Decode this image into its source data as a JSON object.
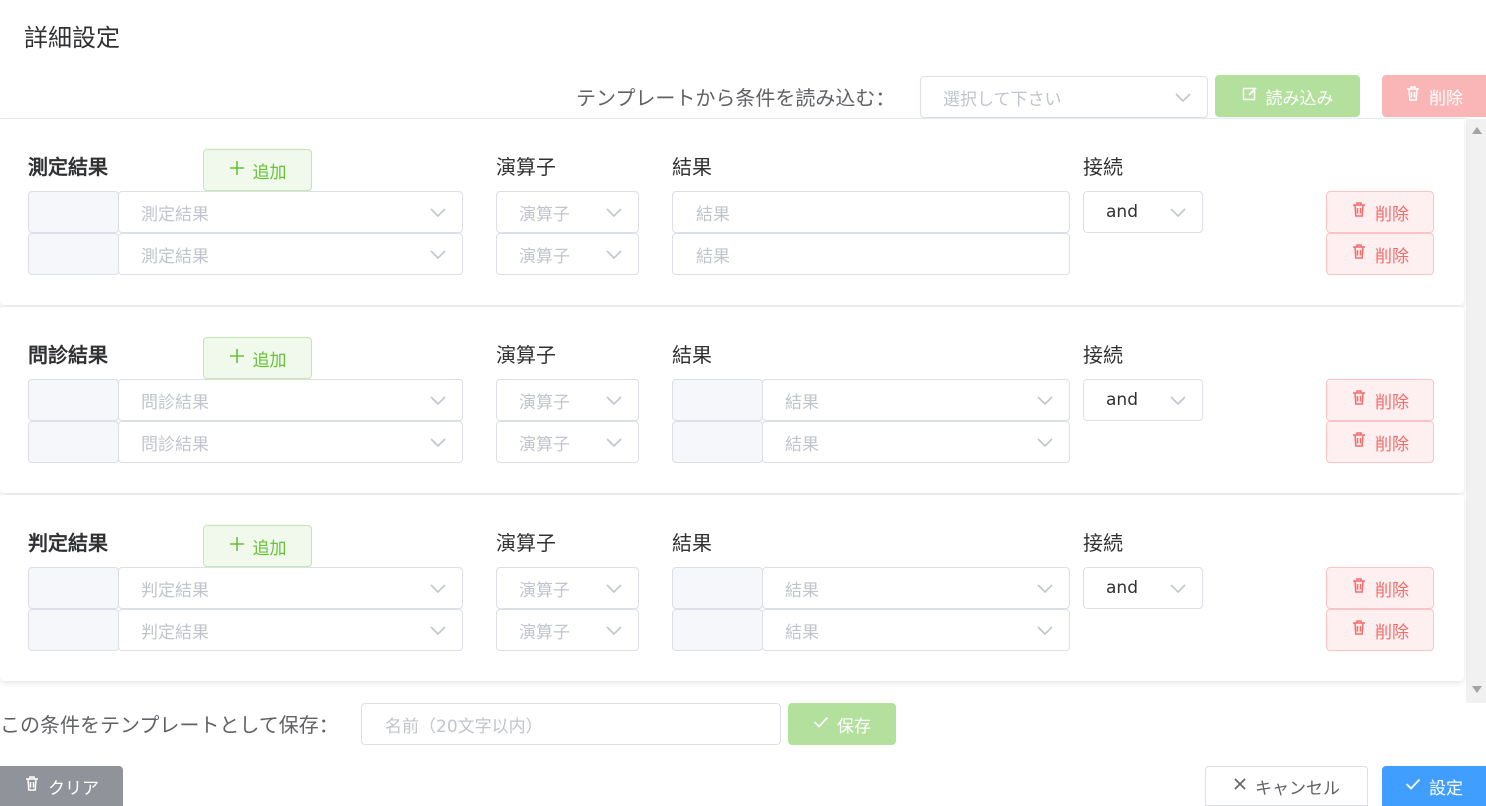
{
  "dialog": {
    "title": "詳細設定"
  },
  "template_load": {
    "label": "テンプレートから条件を読み込む：",
    "select_placeholder": "選択して下さい",
    "load_button": "読み込み",
    "delete_button": "削除"
  },
  "colors": {
    "success": "#67c23a",
    "danger": "#f56c6c",
    "primary": "#409eff",
    "info": "#909399"
  },
  "sections": [
    {
      "title": "測定結果",
      "add_button": "追加",
      "operator_header": "演算子",
      "result_header": "結果",
      "connect_header": "接続",
      "connect_value": "and",
      "rows": [
        {
          "item_placeholder": "測定結果",
          "operator_placeholder": "演算子",
          "result_placeholder": "結果",
          "delete_label": "削除"
        },
        {
          "item_placeholder": "測定結果",
          "operator_placeholder": "演算子",
          "result_placeholder": "結果",
          "delete_label": "削除"
        }
      ]
    },
    {
      "title": "問診結果",
      "add_button": "追加",
      "operator_header": "演算子",
      "result_header": "結果",
      "connect_header": "接続",
      "connect_value": "and",
      "rows": [
        {
          "item_placeholder": "問診結果",
          "operator_placeholder": "演算子",
          "result_placeholder": "結果",
          "delete_label": "削除"
        },
        {
          "item_placeholder": "問診結果",
          "operator_placeholder": "演算子",
          "result_placeholder": "結果",
          "delete_label": "削除"
        }
      ]
    },
    {
      "title": "判定結果",
      "add_button": "追加",
      "operator_header": "演算子",
      "result_header": "結果",
      "connect_header": "接続",
      "connect_value": "and",
      "rows": [
        {
          "item_placeholder": "判定結果",
          "operator_placeholder": "演算子",
          "result_placeholder": "結果",
          "delete_label": "削除"
        },
        {
          "item_placeholder": "判定結果",
          "operator_placeholder": "演算子",
          "result_placeholder": "結果",
          "delete_label": "削除"
        }
      ]
    }
  ],
  "template_save": {
    "label": "この条件をテンプレートとして保存：",
    "name_placeholder": "名前（20文字以内）",
    "save_button": "保存"
  },
  "footer": {
    "clear_button": "クリア",
    "cancel_button": "キャンセル",
    "confirm_button": "設定"
  }
}
